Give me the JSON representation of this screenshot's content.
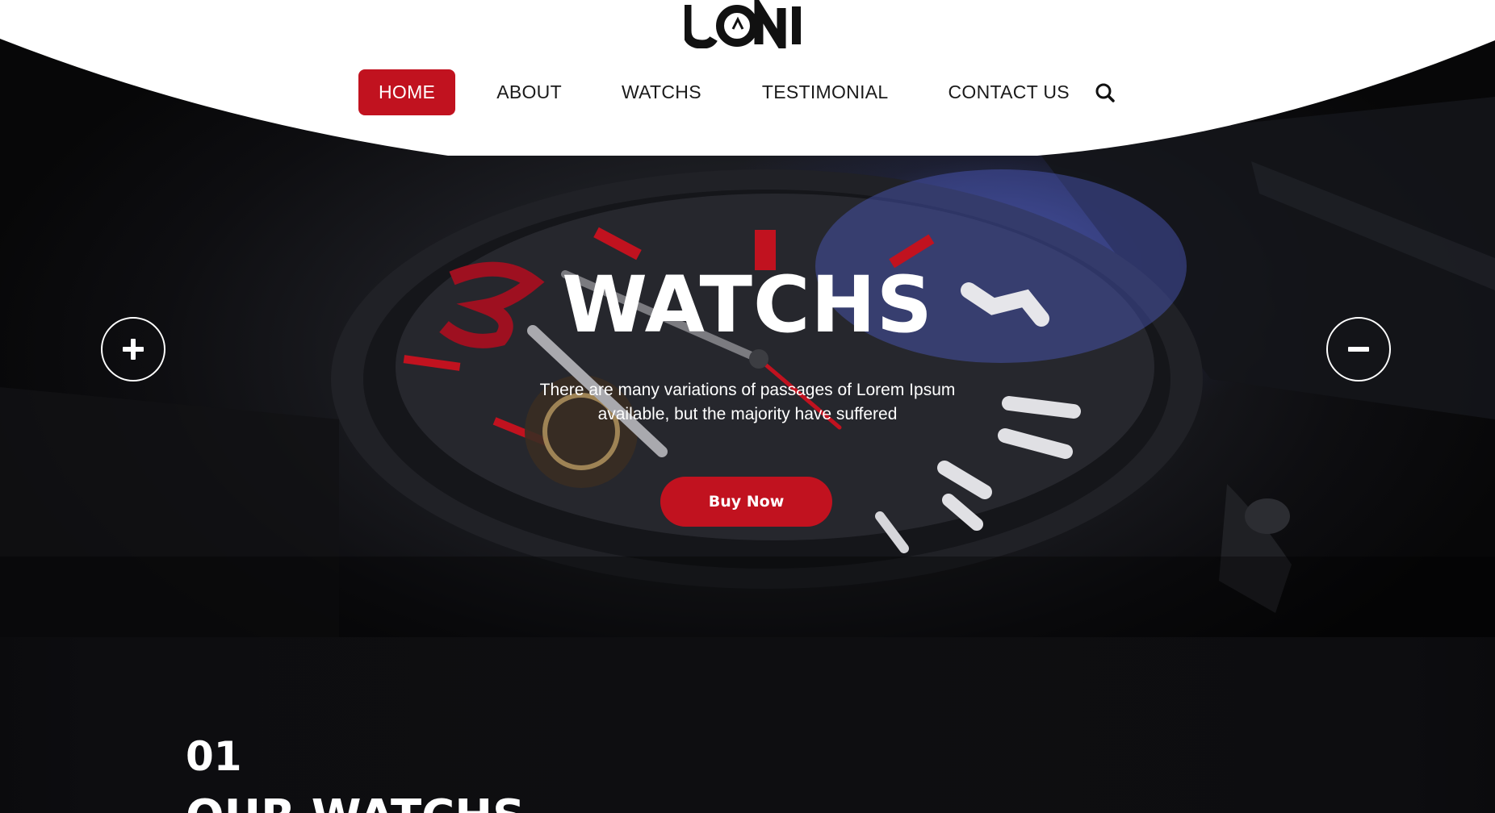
{
  "brand": {
    "logo_text": "UONI"
  },
  "nav": {
    "items": [
      {
        "label": "HOME",
        "active": true
      },
      {
        "label": "ABOUT",
        "active": false
      },
      {
        "label": "WATCHS",
        "active": false
      },
      {
        "label": "TESTIMONIAL",
        "active": false
      },
      {
        "label": "CONTACT US",
        "active": false
      }
    ],
    "search_icon": "search-icon"
  },
  "hero": {
    "title": "WATCHS",
    "subtitle_line1": "There are many variations of passages of Lorem Ipsum",
    "subtitle_line2": "available, but the majority have suffered",
    "button_label": "Buy Now",
    "prev_icon": "plus-icon",
    "next_icon": "minus-icon"
  },
  "section": {
    "number": "01",
    "title": "OUR WATCHS"
  },
  "colors": {
    "accent": "#c1121f",
    "header_bg": "#ffffff",
    "hero_bg": "#0b0b0d",
    "text_light": "#ffffff",
    "text_dark": "#1a1a1a"
  }
}
